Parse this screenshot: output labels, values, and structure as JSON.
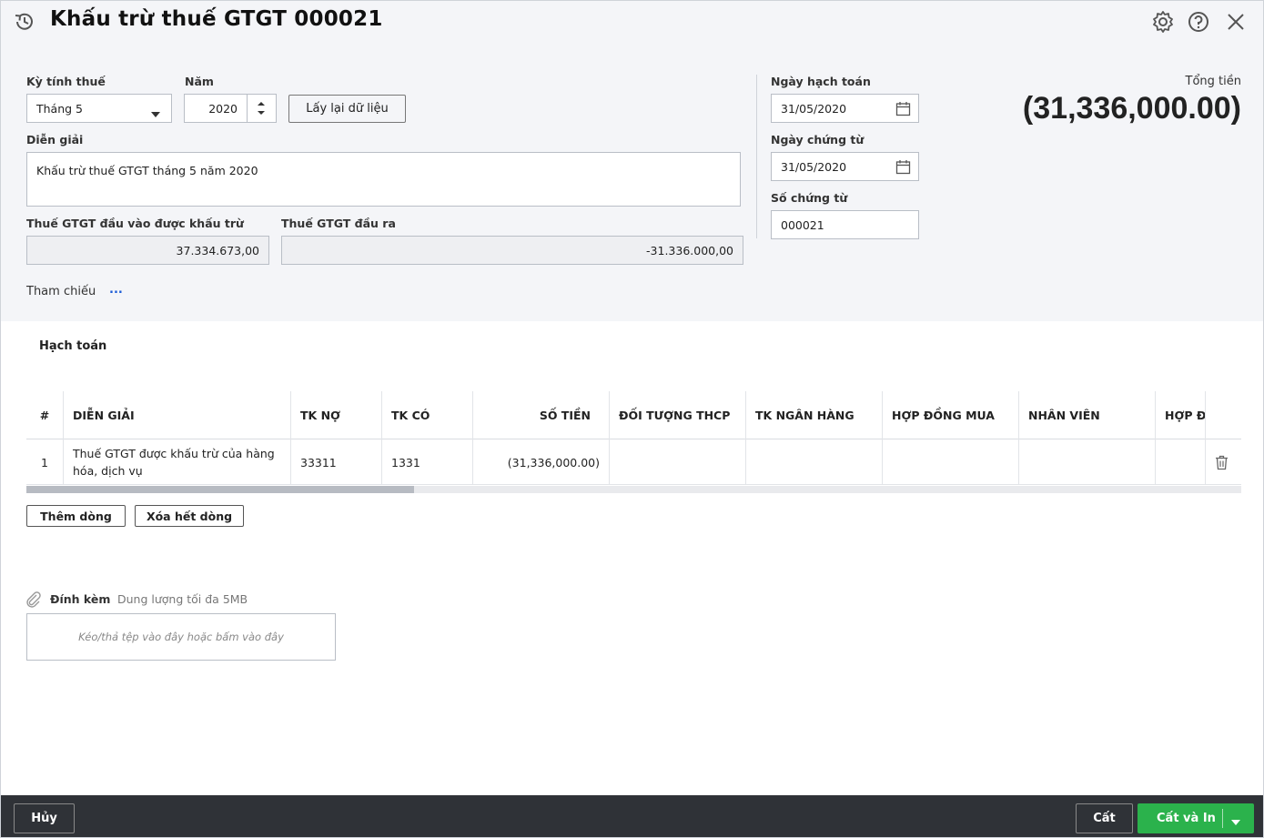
{
  "window": {
    "title": "Khấu trừ thuế GTGT 000021"
  },
  "form": {
    "tax_period_label": "Kỳ tính thuế",
    "tax_period_value": "Tháng 5",
    "year_label": "Năm",
    "year_value": "2020",
    "reload_button": "Lấy lại dữ liệu",
    "description_label": "Diễn giải",
    "description_value": "Khấu trừ thuế GTGT tháng 5 năm 2020",
    "input_vat_label": "Thuế GTGT đầu vào được khấu trừ",
    "input_vat_value": "37.334.673,00",
    "output_vat_label": "Thuế GTGT đầu ra",
    "output_vat_value": "-31.336.000,00",
    "reference_label": "Tham chiếu",
    "reference_more": "...",
    "posting_date_label": "Ngày hạch toán",
    "posting_date_value": "31/05/2020",
    "voucher_date_label": "Ngày chứng từ",
    "voucher_date_value": "31/05/2020",
    "voucher_no_label": "Số chứng từ",
    "voucher_no_value": "000021",
    "total_label": "Tổng tiền",
    "total_value": "(31,336,000.00)"
  },
  "accounting": {
    "section_title": "Hạch toán",
    "columns": [
      "#",
      "DIỄN GIẢI",
      "TK NỢ",
      "TK CÓ",
      "SỐ TIỀN",
      "ĐỐI TƯỢNG THCP",
      "TK NGÂN HÀNG",
      "HỢP ĐỒNG MUA",
      "NHÂN VIÊN",
      "HỢP ĐỒ"
    ],
    "rows": [
      {
        "no": "1",
        "description_line1": "Thuế GTGT được khấu trừ của hàng",
        "description_line2": "hóa, dịch vụ",
        "debit": "33311",
        "credit": "1331",
        "amount": "(31,336,000.00)"
      }
    ],
    "add_row_button": "Thêm dòng",
    "clear_rows_button": "Xóa hết dòng"
  },
  "attachment": {
    "label": "Đính kèm",
    "hint": "Dung lượng tối đa 5MB",
    "drop_text": "Kéo/thả tệp vào đây hoặc bấm vào đây"
  },
  "footer": {
    "cancel": "Hủy",
    "save": "Cất",
    "save_print": "Cất và In"
  },
  "colors": {
    "accent_green": "#2bb24c",
    "footer_bg": "#2f3237",
    "panel_bg": "#f4f5f8"
  }
}
